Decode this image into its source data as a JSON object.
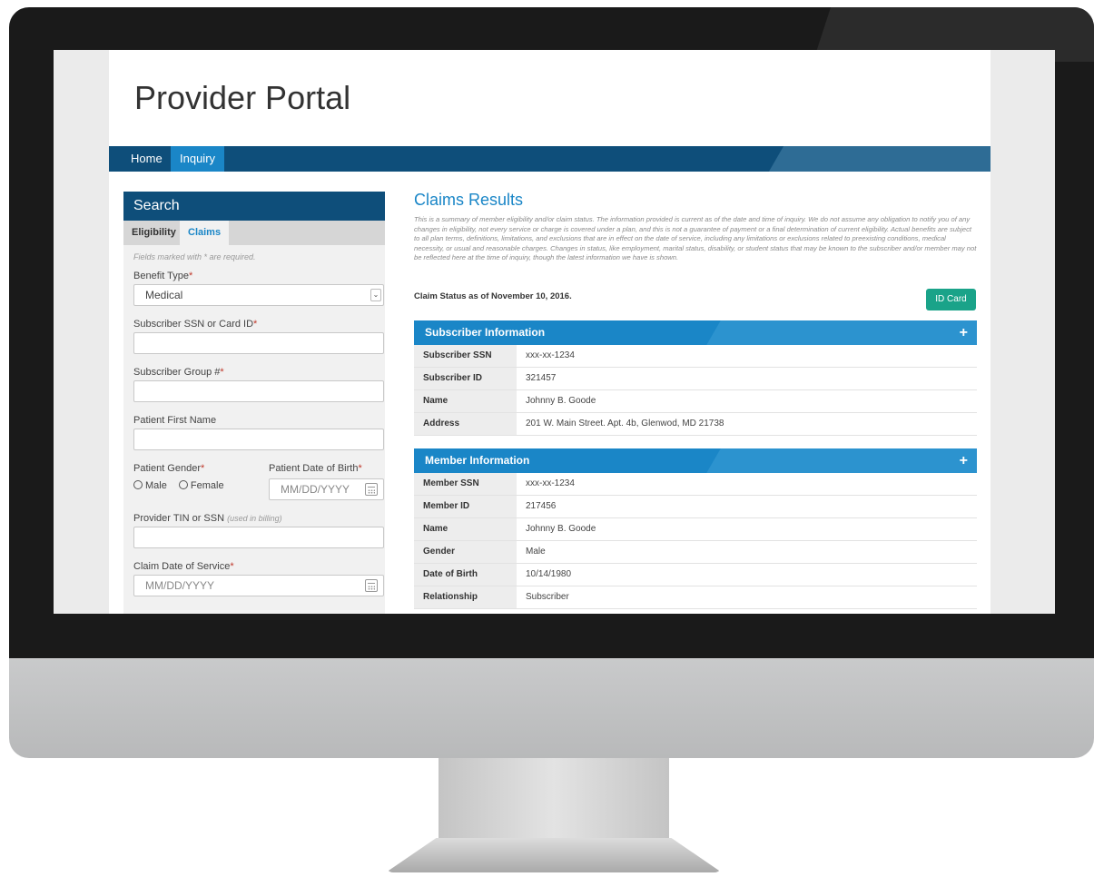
{
  "app": {
    "title": "Provider Portal"
  },
  "nav": {
    "items": [
      "Home",
      "Inquiry"
    ]
  },
  "search": {
    "heading": "Search",
    "tabs": [
      "Eligibility",
      "Claims"
    ],
    "required_note": "Fields marked with * are required.",
    "benefit_type_label": "Benefit Type",
    "benefit_type_value": "Medical",
    "ssn_label": "Subscriber SSN or Card ID",
    "group_label": "Subscriber Group #",
    "first_name_label": "Patient First Name",
    "gender_label": "Patient Gender",
    "gender_options": [
      "Male",
      "Female"
    ],
    "dob_label": "Patient Date of Birth",
    "dob_placeholder": "MM/DD/YYYY",
    "tin_label": "Provider TIN or SSN",
    "tin_hint": "(used in billing)",
    "service_date_label": "Claim Date of Service",
    "service_date_placeholder": "MM/DD/YYYY",
    "required_marker": "*"
  },
  "results": {
    "title": "Claims Results",
    "disclaimer": "This is a summary of member eligibility and/or claim status. The information provided is current as of the date and time of inquiry. We do not assume any obligation to notify you of any changes in eligibility, not every service or charge is covered under a plan, and this is not a guarantee of payment or a final determination of current eligibility. Actual benefits are subject to all plan terms, definitions, limitations, and exclusions that are in effect on the date of service, including any limitations or exclusions related to preexisting conditions, medical necessity, or usual and reasonable charges. Changes in status, like employment, marital status, disability, or student status that may be known to the subscriber and/or member may not be reflected here at the time of inquiry, though the latest information we have is shown.",
    "status_line": "Claim Status as of November 10, 2016.",
    "id_card_button": "ID Card",
    "expand_symbol": "+",
    "subscriber": {
      "heading": "Subscriber Information",
      "rows": [
        {
          "label": "Subscriber SSN",
          "value": "xxx-xx-1234"
        },
        {
          "label": "Subscriber ID",
          "value": "321457"
        },
        {
          "label": "Name",
          "value": "Johnny B. Goode"
        },
        {
          "label": "Address",
          "value": "201 W. Main Street. Apt. 4b, Glenwod, MD 21738"
        }
      ]
    },
    "member": {
      "heading": "Member Information",
      "rows": [
        {
          "label": "Member SSN",
          "value": "xxx-xx-1234"
        },
        {
          "label": "Member ID",
          "value": "217456"
        },
        {
          "label": "Name",
          "value": "Johnny B. Goode"
        },
        {
          "label": "Gender",
          "value": "Male"
        },
        {
          "label": "Date of Birth",
          "value": "10/14/1980"
        },
        {
          "label": "Relationship",
          "value": "Subscriber"
        }
      ]
    }
  },
  "colors": {
    "nav_bg": "#0e4e7a",
    "accent_blue": "#1a86c7",
    "button_green": "#1aa389",
    "required_red": "#c0392b"
  }
}
